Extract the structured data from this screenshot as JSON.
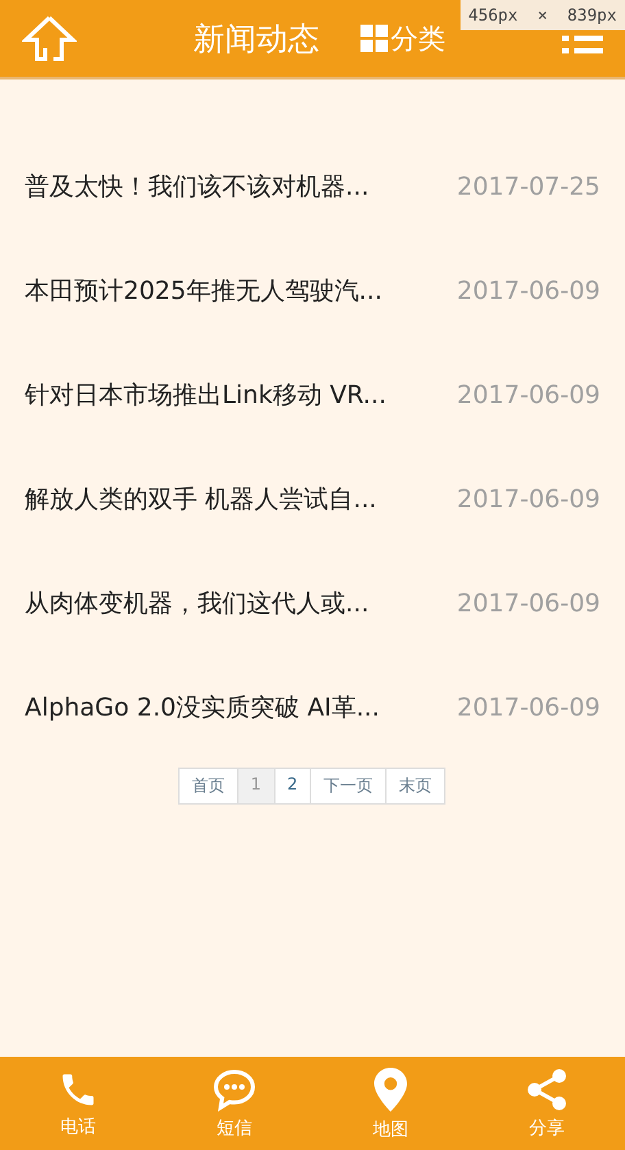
{
  "header": {
    "title": "新闻动态",
    "category_label": "分类"
  },
  "size_overlay": "456px  ×  839px",
  "news": [
    {
      "title": "普及太快！我们该不该对机器...",
      "date": "2017-07-25"
    },
    {
      "title": "本田预计2025年推无人驾驶汽...",
      "date": "2017-06-09"
    },
    {
      "title": "针对日本市场推出Link移动 VR...",
      "date": "2017-06-09"
    },
    {
      "title": "解放人类的双手 机器人尝试自...",
      "date": "2017-06-09"
    },
    {
      "title": "从肉体变机器，我们这代人或...",
      "date": "2017-06-09"
    },
    {
      "title": "AlphaGo 2.0没实质突破 AI革...",
      "date": "2017-06-09"
    }
  ],
  "pagination": [
    {
      "label": "首页",
      "kind": "nav",
      "selected": false
    },
    {
      "label": "1",
      "kind": "page",
      "selected": true
    },
    {
      "label": "2",
      "kind": "page",
      "selected": false
    },
    {
      "label": "下一页",
      "kind": "nav",
      "selected": false
    },
    {
      "label": "末页",
      "kind": "nav",
      "selected": false
    }
  ],
  "bottom_nav": [
    {
      "label": "电话",
      "kind": "phone"
    },
    {
      "label": "短信",
      "kind": "sms"
    },
    {
      "label": "地图",
      "kind": "map"
    },
    {
      "label": "分享",
      "kind": "share"
    }
  ]
}
